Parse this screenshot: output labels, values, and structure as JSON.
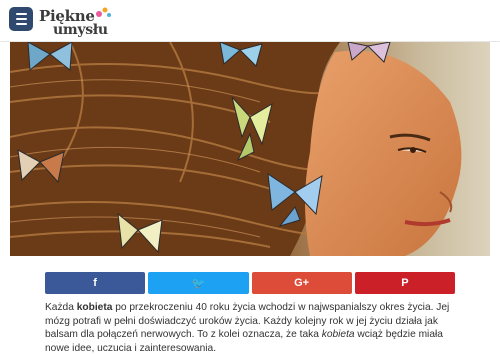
{
  "site": {
    "logo_line1": "Piękne",
    "logo_line2": "umysłu",
    "menu_icon": "hamburger-menu-icon",
    "brand_color": "#2f4a6e"
  },
  "share": {
    "facebook": {
      "icon": "facebook-icon",
      "glyph": "f",
      "color": "#3b5998"
    },
    "twitter": {
      "icon": "twitter-icon",
      "glyph": "🐦",
      "color": "#1da1f2"
    },
    "googleplus": {
      "icon": "google-plus-icon",
      "glyph": "G+",
      "color": "#dd4b39"
    },
    "pinterest": {
      "icon": "pinterest-icon",
      "glyph": "P",
      "color": "#cb2027"
    }
  },
  "article": {
    "s1_pre": "Każda ",
    "s1_bold": "kobieta",
    "s1_post": " po przekroczeniu 40 roku życia wchodzi w najwspanialszy okres życia. Jej mózg potrafi w pełni doświadczyć uroków życia. Każdy kolejny rok w jej życiu działa jak balsam dla połączeń nerwowych. To z kolei oznacza, że taka ",
    "s2_italic": "kobieta",
    "s2_post": " wciąż będzie miała nowe idee, uczucia i zainteresowania."
  }
}
